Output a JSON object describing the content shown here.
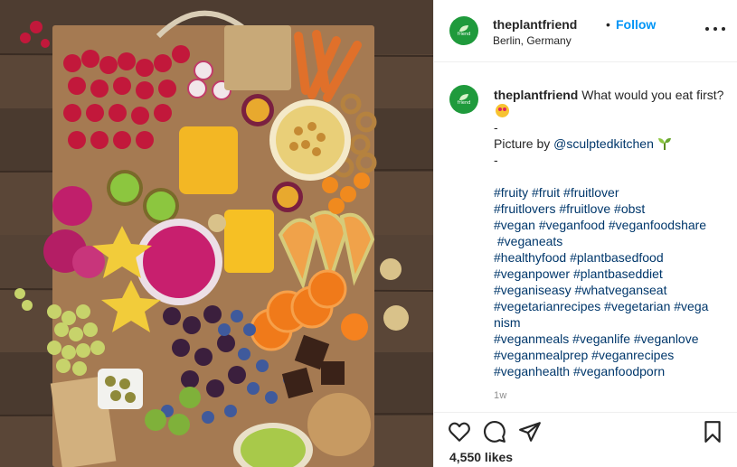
{
  "post": {
    "username": "theplantfriend",
    "separator": "•",
    "follow_label": "Follow",
    "location": "Berlin, Germany",
    "avatar_text": "friend",
    "caption": {
      "username": "theplantfriend",
      "text": "What would you eat first?",
      "emoji": "star-struck-emoji",
      "dash1": "-",
      "picture_by": "Picture by",
      "credit": "@sculptedkitchen",
      "credit_emoji": "seedling-emoji",
      "dash2": "-",
      "hashtag_lines": [
        "#fruity #fruit #fruitlover",
        "#fruitlovers #fruitlove #obst",
        "#vegan #veganfood #veganfoodshare",
        " #veganeats",
        "#healthyfood #plantbasedfood",
        "#veganpower #plantbaseddiet",
        "#veganiseasy #whatveganseat",
        "#vegetarianrecipes #vegetarian #vega",
        "nism",
        "#veganmeals #veganlife #veganlove",
        "#veganmealprep #veganrecipes",
        "#veganhealth #veganfoodporn"
      ]
    },
    "time_ago": "1w",
    "likes": "4,550 likes",
    "icons": {
      "like": "heart-icon",
      "comment": "comment-icon",
      "share": "share-icon",
      "save": "bookmark-icon",
      "more": "more-options-icon"
    },
    "colors": {
      "follow": "#0095f6",
      "hashtag": "#00376b",
      "avatar": "#1f9a3c",
      "muted": "#8e8e8e"
    }
  },
  "photo": {
    "subject": "fruit-platter-photo"
  }
}
